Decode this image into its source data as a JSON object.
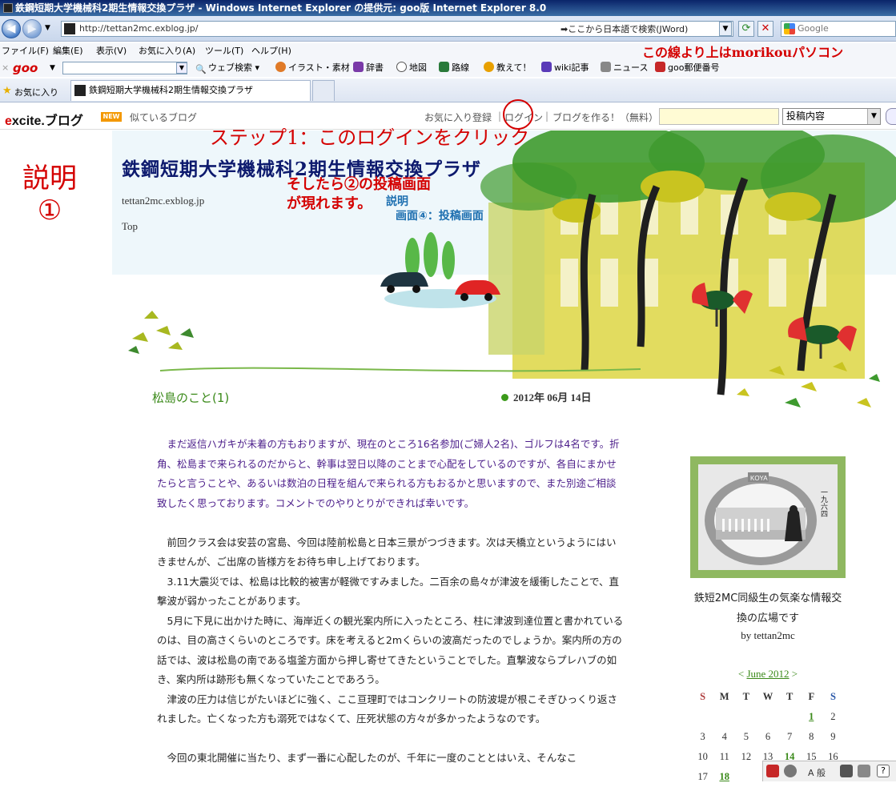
{
  "window": {
    "title": "鉄鋼短期大学機械科2期生情報交換プラザ - Windows Internet Explorer の提供元: goo版 Internet Explorer 8.0"
  },
  "address": {
    "url": "http://tettan2mc.exblog.jp/",
    "search_hint": "➡ここから日本語で検索(JWord)",
    "search_placeholder": "Google"
  },
  "menu": {
    "items": [
      "ファイル(F)",
      "編集(E)",
      "表示(V)",
      "お気に入り(A)",
      "ツール(T)",
      "ヘルプ(H)"
    ]
  },
  "goo_toolbar": {
    "logo": "goo",
    "web_search": "ウェブ検索",
    "items": [
      "イラスト・素材",
      "辞書",
      "地図",
      "路線",
      "教えて！",
      "wiki記事",
      "ニュース",
      "goo郵便番号"
    ]
  },
  "favorites_bar": {
    "label": "お気に入り",
    "tab_title": "鉄鋼短期大学機械科2期生情報交換プラザ"
  },
  "excite": {
    "logo_e": "e",
    "logo_rest": "xcite.ブログ",
    "new_badge": "NEW",
    "similar": "似ているブログ",
    "fav_register": "お気に入り登録",
    "login": "ログイン",
    "make_blog": "ブログを作る！（無料）",
    "search_select": "投稿内容"
  },
  "blog": {
    "title": "鉄鋼短期大学機械科2期生情報交換プラザ",
    "url": "tettan2mc.exblog.jp",
    "top": "Top"
  },
  "annotations": {
    "top_note": "この線より上はmorikouパソコン",
    "step1": "ステップ1：このログインをクリック",
    "then1": "そしたら②の投稿画面",
    "then2": "が現れます。",
    "explain_small": "説明",
    "screen4": "画面④：投稿画面",
    "setsumei_1": "説明",
    "setsumei_2": "①"
  },
  "post": {
    "title": "松島のこと(1)",
    "date": "2012年 06月 14日",
    "paragraphs": [
      "　まだ返信ハガキが未着の方もおりますが、現在のところ16名参加(ご婦人2名)、ゴルフは4名です。折角、松島まで来られるのだからと、幹事は翌日以降のことまで心配をしているのですが、各自にまかせたらと言うことや、あるいは数泊の日程を組んで来られる方もおるかと思いますので、また別途ご相談致したく思っております。コメントでのやりとりができれば幸いです。",
      "　前回クラス会は安芸の宮島、今回は陸前松島と日本三景がつづきます。次は天橋立というようにはいきませんが、ご出席の皆様方をお待ち申し上げております。",
      "　3.11大震災では、松島は比較的被害が軽微ですみました。二百余の島々が津波を緩衝したことで、直撃波が弱かったことがあります。",
      "　5月に下見に出かけた時に、海岸近くの観光案内所に入ったところ、柱に津波到達位置と書かれているのは、目の高さくらいのところです。床を考えると2mくらいの波高だったのでしょうか。案内所の方の話では、波は松島の南である塩釜方面から押し寄せてきたということでした。直撃波ならプレハブの如き、案内所は跡形も無くなっていたことであろう。",
      "　津波の圧力は信じがたいほどに強く、ここ亘理町ではコンクリートの防波堤が根こそぎひっくり返されました。亡くなった方も溺死ではなくて、圧死状態の方々が多かったようなのです。",
      "　今回の東北開催に当たり、まず一番に心配したのが、千年に一度のこととはいえ、そんなこ"
    ]
  },
  "sidebar": {
    "caption": "鉄短2MC同級生の気楽な情報交換の広場です",
    "by": "by tettan2mc",
    "photo_sign": "KOYA",
    "photo_side": "一九六四"
  },
  "calendar": {
    "prev": "<",
    "month": "June 2012",
    "next": ">",
    "weekdays": [
      "S",
      "M",
      "T",
      "W",
      "T",
      "F",
      "S"
    ],
    "rows": [
      [
        "",
        "",
        "",
        "",
        "",
        "1",
        "2"
      ],
      [
        "3",
        "4",
        "5",
        "6",
        "7",
        "8",
        "9"
      ],
      [
        "10",
        "11",
        "12",
        "13",
        "14",
        "15",
        "16"
      ],
      [
        "17",
        "18",
        "",
        "",
        "",
        "",
        ""
      ]
    ],
    "linked_days": [
      "1",
      "14",
      "18"
    ]
  },
  "tray": {
    "label": "A 般"
  },
  "colors": {
    "accent_red": "#d40000",
    "title_navy": "#0d1a6e",
    "post_green": "#3b8a1a",
    "frame_green": "#8fb860"
  }
}
